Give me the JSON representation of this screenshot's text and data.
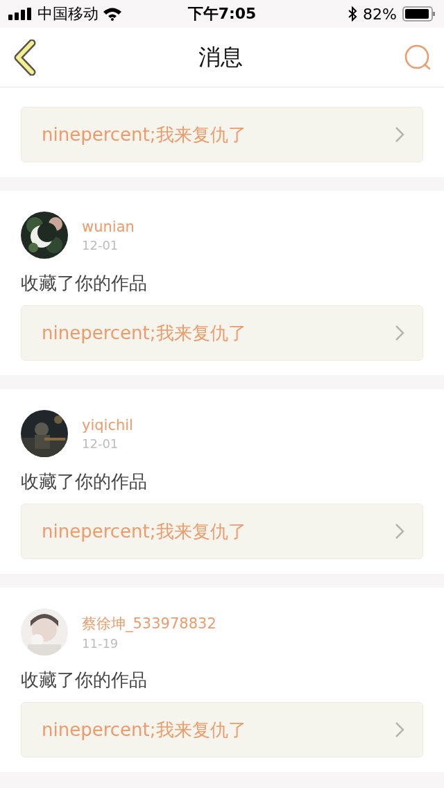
{
  "status_bar": {
    "carrier": "中国移动",
    "time": "下午7:05",
    "battery": "82%"
  },
  "header": {
    "title": "消息"
  },
  "messages": [
    {
      "link": "ninepercent;我来复仇了"
    },
    {
      "user": "wunian",
      "date": "12-01",
      "action": "收藏了你的作品",
      "link": "ninepercent;我来复仇了"
    },
    {
      "user": "yiqichil",
      "date": "12-01",
      "action": "收藏了你的作品",
      "link": "ninepercent;我来复仇了"
    },
    {
      "user": "蔡徐坤_533978832",
      "date": "11-19",
      "action": "收藏了你的作品",
      "link": "ninepercent;我来复仇了"
    }
  ]
}
